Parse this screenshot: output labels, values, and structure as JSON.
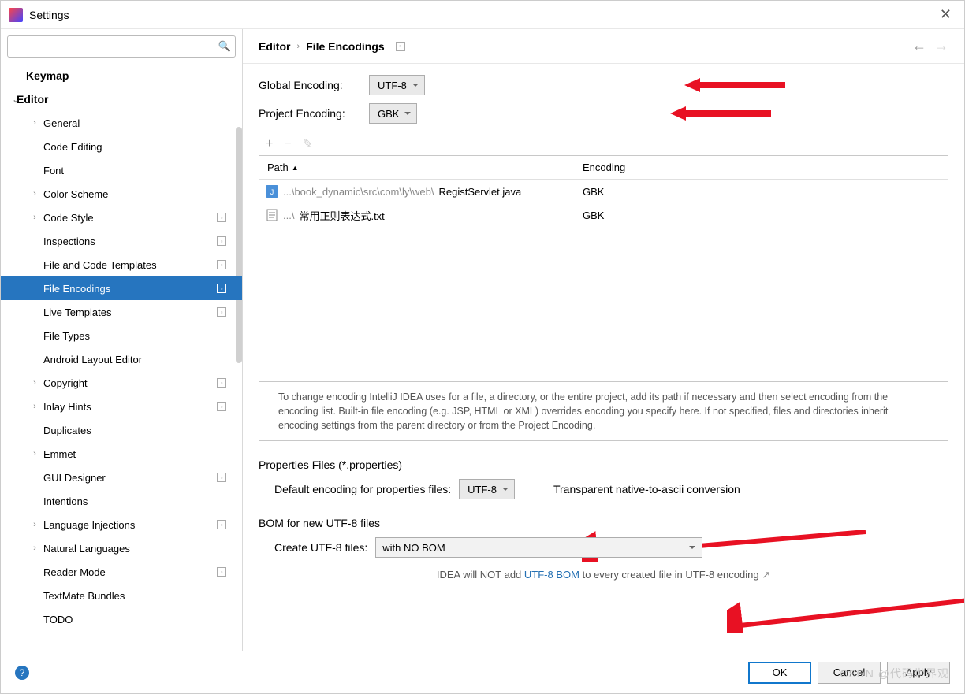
{
  "window_title": "Settings",
  "sidebar": {
    "items": [
      {
        "label": "Keymap",
        "level": 1,
        "arrow": "",
        "bold": true
      },
      {
        "label": "Editor",
        "level": 0,
        "arrow": "⌄",
        "bold": true
      },
      {
        "label": "General",
        "level": 2,
        "arrow": "›"
      },
      {
        "label": "Code Editing",
        "level": 2,
        "arrow": ""
      },
      {
        "label": "Font",
        "level": 2,
        "arrow": ""
      },
      {
        "label": "Color Scheme",
        "level": 2,
        "arrow": "›"
      },
      {
        "label": "Code Style",
        "level": 2,
        "arrow": "›",
        "badge": true
      },
      {
        "label": "Inspections",
        "level": 2,
        "arrow": "",
        "badge": true
      },
      {
        "label": "File and Code Templates",
        "level": 2,
        "arrow": "",
        "badge": true
      },
      {
        "label": "File Encodings",
        "level": 2,
        "arrow": "",
        "badge": true,
        "selected": true
      },
      {
        "label": "Live Templates",
        "level": 2,
        "arrow": "",
        "badge": true
      },
      {
        "label": "File Types",
        "level": 2,
        "arrow": ""
      },
      {
        "label": "Android Layout Editor",
        "level": 2,
        "arrow": ""
      },
      {
        "label": "Copyright",
        "level": 2,
        "arrow": "›",
        "badge": true
      },
      {
        "label": "Inlay Hints",
        "level": 2,
        "arrow": "›",
        "badge": true
      },
      {
        "label": "Duplicates",
        "level": 2,
        "arrow": ""
      },
      {
        "label": "Emmet",
        "level": 2,
        "arrow": "›"
      },
      {
        "label": "GUI Designer",
        "level": 2,
        "arrow": "",
        "badge": true
      },
      {
        "label": "Intentions",
        "level": 2,
        "arrow": ""
      },
      {
        "label": "Language Injections",
        "level": 2,
        "arrow": "›",
        "badge": true
      },
      {
        "label": "Natural Languages",
        "level": 2,
        "arrow": "›"
      },
      {
        "label": "Reader Mode",
        "level": 2,
        "arrow": "",
        "badge": true
      },
      {
        "label": "TextMate Bundles",
        "level": 2,
        "arrow": ""
      },
      {
        "label": "TODO",
        "level": 2,
        "arrow": ""
      }
    ]
  },
  "breadcrumb": {
    "seg1": "Editor",
    "seg2": "File Encodings"
  },
  "form": {
    "global_encoding_label": "Global Encoding:",
    "global_encoding_value": "UTF-8",
    "project_encoding_label": "Project Encoding:",
    "project_encoding_value": "GBK",
    "table": {
      "col_path": "Path",
      "col_encoding": "Encoding",
      "rows": [
        {
          "path_prefix": "...\\book_dynamic\\src\\com\\ly\\web\\",
          "path_file": "RegistServlet.java",
          "encoding": "GBK",
          "icon": "java"
        },
        {
          "path_prefix": "...\\",
          "path_file": "常用正则表达式.txt",
          "encoding": "GBK",
          "icon": "txt"
        }
      ]
    },
    "hint_text": "To change encoding IntelliJ IDEA uses for a file, a directory, or the entire project, add its path if necessary and then select encoding from the encoding list. Built-in file encoding (e.g. JSP, HTML or XML) overrides encoding you specify here. If not specified, files and directories inherit encoding settings from the parent directory or from the Project Encoding.",
    "properties_section": "Properties Files (*.properties)",
    "properties_label": "Default encoding for properties files:",
    "properties_value": "UTF-8",
    "transparent_label": "Transparent native-to-ascii conversion",
    "bom_section": "BOM for new UTF-8 files",
    "bom_label": "Create UTF-8 files:",
    "bom_value": "with NO BOM",
    "footnote_prefix": "IDEA will NOT add ",
    "footnote_link": "UTF-8 BOM",
    "footnote_suffix": " to every created file in UTF-8 encoding"
  },
  "buttons": {
    "ok": "OK",
    "cancel": "Cancel",
    "apply": "Apply"
  },
  "watermark": "CSDN @代码世界观"
}
